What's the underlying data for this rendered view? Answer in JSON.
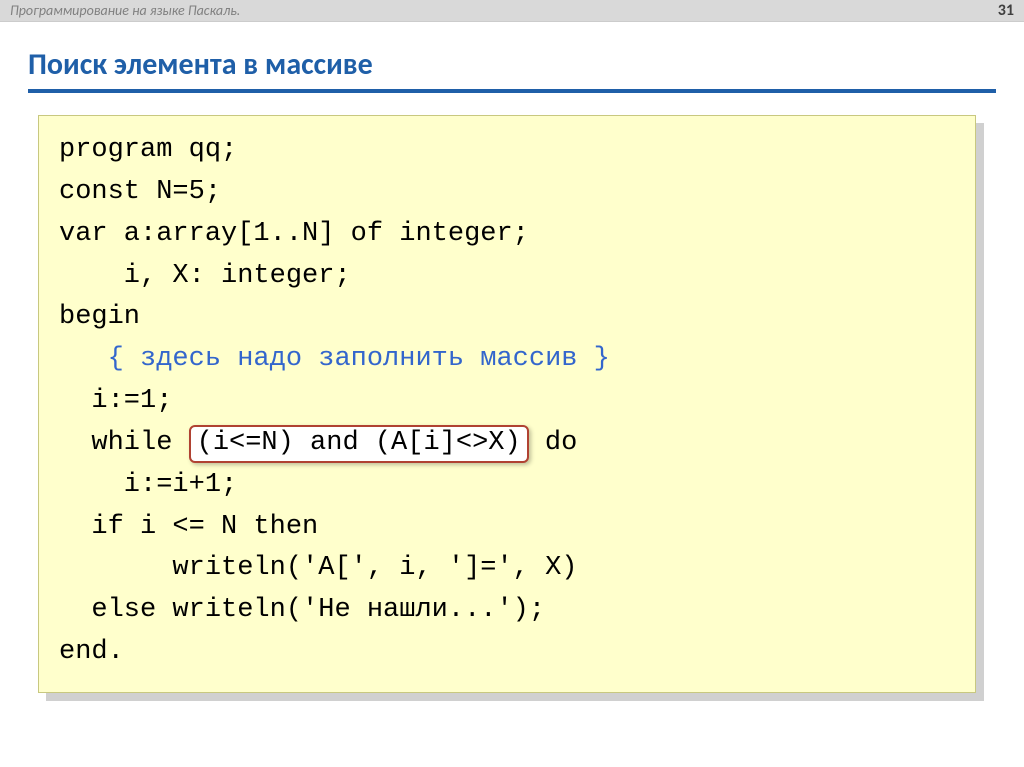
{
  "header": {
    "title": "Программирование на языке Паскаль.",
    "page": "31"
  },
  "slide": {
    "title": "Поиск элемента в массиве"
  },
  "code": {
    "l1": "program qq;",
    "l2": "const N=5;",
    "l3": "var a:array[1..N] of integer;",
    "l4": "    i, X: integer;",
    "l5": "begin",
    "l6": "   { здесь надо заполнить массив }",
    "l7": "  i:=1;",
    "l8a": "  while ",
    "l8b": "(i<=N) and (A[i]<>X)",
    "l8c": " do",
    "l9": "    i:=i+1;",
    "l10": "  if i <= N then",
    "l11": "       writeln('A[', i, ']=', X)",
    "l12": "  else writeln('Не нашли...');",
    "l13": "end."
  }
}
